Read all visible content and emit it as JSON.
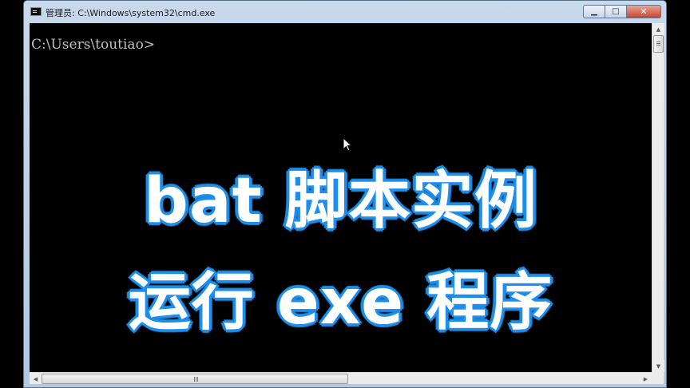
{
  "window": {
    "title": "管理员: C:\\Windows\\system32\\cmd.exe",
    "controls": {
      "minimize": "▁",
      "maximize": "□",
      "close": "✕"
    }
  },
  "console": {
    "prompt": "C:\\Users\\toutiao>"
  },
  "caption": {
    "line1": "bat 脚本实例",
    "line2": "运行 exe 程序"
  },
  "scrollbars": {
    "up_arrow": "▲",
    "down_arrow": "▼",
    "left_arrow": "◀",
    "right_arrow": "▶"
  },
  "colors": {
    "caption_fill": "#ffffff",
    "caption_outline": "#1e8fe8",
    "console_bg": "#000000",
    "console_text": "#c0c0c0"
  },
  "icons": {
    "window": "cmd-window-icon",
    "pointer": "mouse-pointer-icon"
  }
}
